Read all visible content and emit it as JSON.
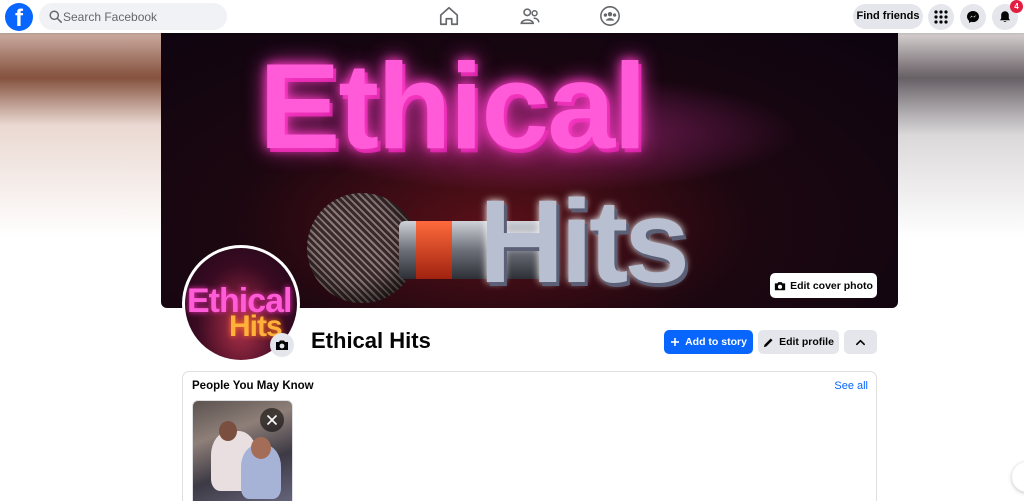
{
  "topbar": {
    "logo_letter": "f",
    "search_placeholder": "Search Facebook",
    "nav_icons": [
      "home-icon",
      "friends-icon",
      "groups-icon"
    ],
    "find_friends_label": "Find friends",
    "right_icons": [
      "menu-grid-icon",
      "messenger-icon",
      "notifications-bell-icon"
    ],
    "notification_count": "4"
  },
  "cover": {
    "title_line1": "Ethical",
    "title_line2": "Hits",
    "edit_cover_label": "Edit cover photo"
  },
  "profile": {
    "avatar_line1": "Ethical",
    "avatar_line2": "Hits",
    "name": "Ethical Hits",
    "add_story_label": "Add to story",
    "edit_profile_label": "Edit profile"
  },
  "pymk": {
    "title": "People You May Know",
    "see_all_label": "See all"
  },
  "colors": {
    "brand_blue": "#0866ff",
    "button_gray": "#e4e6eb",
    "badge_red": "#e41e3f",
    "neon_pink": "#ff5ad8"
  }
}
